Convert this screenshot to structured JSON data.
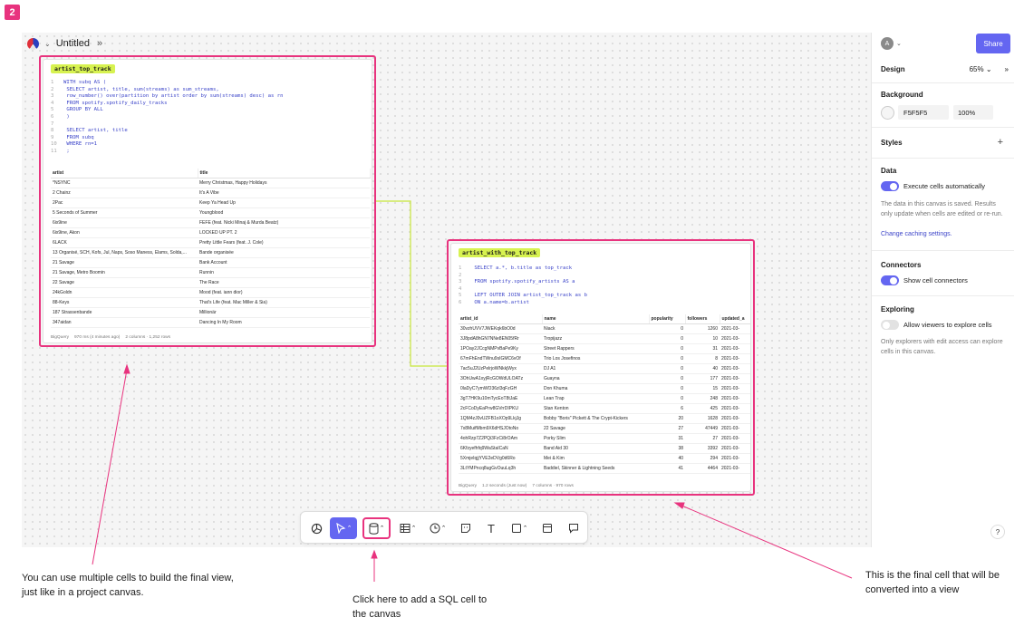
{
  "step_badge": "2",
  "colors": {
    "accent": "#6466f1",
    "highlight": "#e8337e",
    "cell_label_bg": "#d7f250",
    "connector": "#c8e63b"
  },
  "topbar": {
    "title": "Untitled",
    "logo_icon": "app-logo-icon",
    "expand_icon": "double-chevron-right-icon"
  },
  "cell1": {
    "label": "artist_top_track",
    "code": [
      {
        "n": "1",
        "t": "WITH subq AS ("
      },
      {
        "n": "2",
        "t": "   SELECT artist, title, sum(streams) as sum_streams,"
      },
      {
        "n": "3",
        "t": "   row_number() over(partition by artist order by sum(streams) desc) as rn"
      },
      {
        "n": "4",
        "t": "   FROM spotify.spotify_daily_tracks"
      },
      {
        "n": "5",
        "t": "   GROUP BY ALL"
      },
      {
        "n": "6",
        "t": " )"
      },
      {
        "n": "7",
        "t": ""
      },
      {
        "n": "8",
        "t": " SELECT artist, title"
      },
      {
        "n": "9",
        "t": " FROM subq"
      },
      {
        "n": "10",
        "t": " WHERE rn=1"
      },
      {
        "n": "11",
        "t": " ;"
      }
    ],
    "columns": [
      "artist",
      "title"
    ],
    "rows": [
      [
        "*NSYNC",
        "Merry Christmas, Happy Holidays"
      ],
      [
        "2 Chainz",
        "It's A Vibe"
      ],
      [
        "2Pac",
        "Keep Ya Head Up"
      ],
      [
        "5 Seconds of Summer",
        "Youngblood"
      ],
      [
        "6ix9ine",
        "FEFE (feat. Nicki Minaj & Murda Beatz)"
      ],
      [
        "6ix9ine, Akon",
        "LOCKED UP PT. 2"
      ],
      [
        "6LACK",
        "Pretty Little Fears (feat. J. Cole)"
      ],
      [
        "13 Organisé, SCH, Kofs, Jul, Naps, Soso Maness, Elams, Solda,...",
        "Bande organisée"
      ],
      [
        "21 Savage",
        "Bank Account"
      ],
      [
        "21 Savage, Metro Boomin",
        "Runnin"
      ],
      [
        "22 Savage",
        "The Race"
      ],
      [
        "24kGoldn",
        "Mood (feat. iann dior)"
      ],
      [
        "88-Keys",
        "That's Life (feat. Mac Miller & Sia)"
      ],
      [
        "187 Strassenbande",
        "Millionär"
      ],
      [
        "347aidan",
        "Dancing In My Room"
      ]
    ],
    "footer": [
      "BigQuery",
      "970 ms (4 minutes ago)",
      "2 columns · 1,252 rows"
    ]
  },
  "cell2": {
    "label": "artist_with_top_track",
    "code": [
      {
        "n": "1",
        "t": " SELECT a.*, b.title as top_track"
      },
      {
        "n": "2",
        "t": ""
      },
      {
        "n": "3",
        "t": " FROM spotify.spotify_artists AS a"
      },
      {
        "n": "4",
        "t": ""
      },
      {
        "n": "5",
        "t": " LEFT OUTER JOIN artist_top_track as b"
      },
      {
        "n": "6",
        "t": " ON a.name=b.artist"
      }
    ],
    "columns": [
      "artist_id",
      "name",
      "popularity",
      "followers",
      "updated_a"
    ],
    "rows": [
      [
        "30vzhUVV7JWEKqk6bO0d",
        "Niack",
        "0",
        "1260",
        "2021-03-"
      ],
      [
        "3J8pdA8hGN7NNe8EN05fRr",
        "Tropijazz",
        "0",
        "10",
        "2021-03-"
      ],
      [
        "1POay2JCcgNMPvBaPe9Ky",
        "Street Rappers",
        "0",
        "31",
        "2021-03-"
      ],
      [
        "67mFhEndTWnu9sIGMC6vOf",
        "Trio Los Josefinos",
        "0",
        "8",
        "2021-03-"
      ],
      [
        "7ac5uJ2UzPelrjoWNkkjWyx",
        "DJ A1",
        "0",
        "40",
        "2021-03-"
      ],
      [
        "3OhUwA1xyjRcGOWdULOATz",
        "Guayna",
        "0",
        "177",
        "2021-03-"
      ],
      [
        "0laDyC7ymWO36zl3qFzGH",
        "Don Khuma",
        "0",
        "15",
        "2021-03-"
      ],
      [
        "3gT7HK9u10mTycEoT8tJaE",
        "Lean Trap",
        "0",
        "248",
        "2021-03-"
      ],
      [
        "2cFCoDyEaPrw8GVrrDIPKU",
        "Stan Kenton",
        "6",
        "425",
        "2021-03-"
      ],
      [
        "1QM4zJ0vUZFB1oXOp9LkjJg",
        "Bobby \"Boris\" Pickett & The Crypt-Kickers",
        "20",
        "1628",
        "2021-03-"
      ],
      [
        "7x8MuifMbm9X6dHSJOtoNo",
        "22 Savage",
        "27",
        "47449",
        "2021-03-"
      ],
      [
        "4ohRzp7Z2PQi3FzCi8rOAm",
        "Porky Slim",
        "31",
        "27",
        "2021-03-"
      ],
      [
        "6Kfzyefhfq9WaStaICaN",
        "Band Aid 30",
        "38",
        "3392",
        "2021-03-"
      ],
      [
        "5XmjeIqjjYVE2eDVg0d6Ro",
        "Mei & Kim",
        "40",
        "294",
        "2021-03-"
      ],
      [
        "3LtYMPncq8ugGvOuuLq3h",
        "Baddiel, Skinner & Lightning Seeds",
        "41",
        "4464",
        "2021-03-"
      ]
    ],
    "footer": [
      "BigQuery",
      "1.2 seconds (Just now)",
      "7 columns · 970 rows"
    ]
  },
  "toolbar": {
    "items": [
      "chart-icon",
      "pointer-icon",
      "sql-cell-icon",
      "table-icon",
      "clock-icon",
      "sticky-note-icon",
      "text-icon",
      "shape-icon",
      "frame-icon",
      "comment-icon"
    ],
    "text_label": "T"
  },
  "panel": {
    "avatar": "A",
    "share": "Share",
    "design": "Design",
    "zoom": "65%",
    "background": "Background",
    "bg_hex": "F5F5F5",
    "bg_opacity": "100%",
    "styles": "Styles",
    "data": "Data",
    "execute_label": "Execute cells automatically",
    "data_note": "The data in this canvas is saved. Results only update when cells are edited or re-run.",
    "caching_link": "Change caching settings.",
    "connectors": "Connectors",
    "connectors_label": "Show cell connectors",
    "exploring": "Exploring",
    "explore_label": "Allow viewers to explore cells",
    "explore_note": "Only explorers with edit access can explore cells in this canvas.",
    "help": "?"
  },
  "annotations": {
    "left": "You can use multiple cells to build the final view, just like in a project canvas.",
    "middle": "Click here to add a SQL cell to the canvas",
    "right": "This is the final cell that will be converted into a view"
  }
}
